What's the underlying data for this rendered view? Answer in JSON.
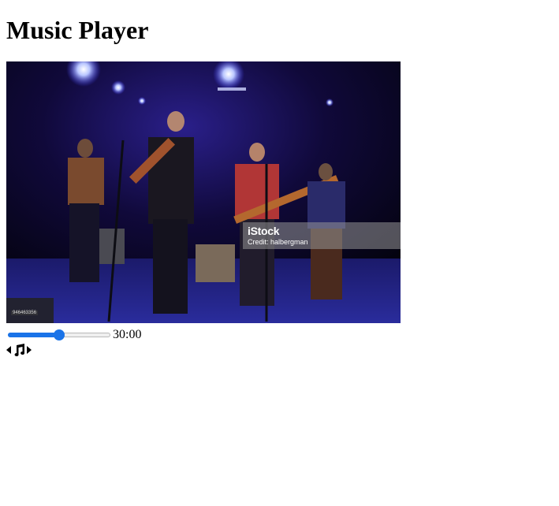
{
  "page": {
    "title": "Music Player"
  },
  "image": {
    "alt": "Band performing on stage",
    "watermark_brand": "iStock",
    "watermark_credit": "Credit: halbergman",
    "stock_id": "946463356"
  },
  "player": {
    "time": "30:00",
    "seek_progress_percent": 50,
    "prev_icon": "caret-left-icon",
    "play_icon": "music-note-icon",
    "next_icon": "caret-right-icon"
  },
  "colors": {
    "accent": "#1a73e8"
  }
}
